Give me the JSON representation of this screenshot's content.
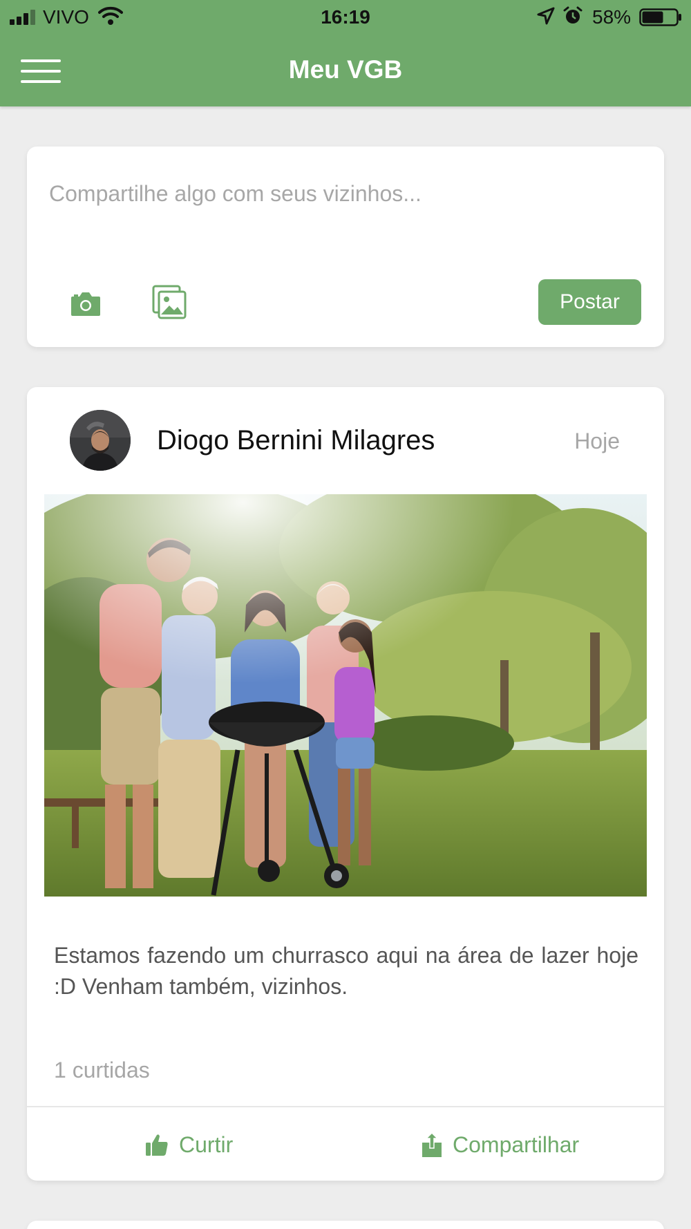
{
  "status_bar": {
    "carrier": "VIVO",
    "time": "16:19",
    "battery_percent": "58%",
    "battery_level": 0.58,
    "icons": [
      "signal-icon",
      "wifi-icon",
      "location-arrow-icon",
      "alarm-icon",
      "battery-icon"
    ]
  },
  "header": {
    "title": "Meu VGB",
    "menu_icon": "hamburger-menu-icon"
  },
  "composer": {
    "placeholder": "Compartilhe algo com seus vizinhos...",
    "value": "",
    "camera_icon": "camera-icon",
    "gallery_icon": "image-gallery-icon",
    "post_label": "Postar"
  },
  "post": {
    "author": "Diogo Bernini Milagres",
    "time": "Hoje",
    "text": "Estamos fazendo um churrasco aqui na área de lazer hoje :D Venham também, vizinhos.",
    "likes": "1 curtidas",
    "like_label": "Curtir",
    "share_label": "Compartilhar",
    "like_icon": "thumbs-up-icon",
    "share_icon": "share-icon"
  },
  "colors": {
    "accent": "#6faa6b",
    "background": "#ededed",
    "card": "#ffffff",
    "muted_text": "#a6a6a6"
  }
}
